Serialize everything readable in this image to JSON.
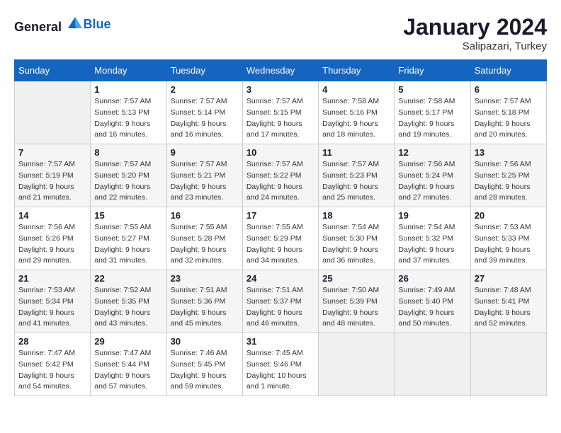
{
  "logo": {
    "text_general": "General",
    "text_blue": "Blue"
  },
  "title": "January 2024",
  "subtitle": "Salipazari, Turkey",
  "weekdays": [
    "Sunday",
    "Monday",
    "Tuesday",
    "Wednesday",
    "Thursday",
    "Friday",
    "Saturday"
  ],
  "weeks": [
    [
      {
        "day": "",
        "info": ""
      },
      {
        "day": "1",
        "info": "Sunrise: 7:57 AM\nSunset: 5:13 PM\nDaylight: 9 hours\nand 16 minutes."
      },
      {
        "day": "2",
        "info": "Sunrise: 7:57 AM\nSunset: 5:14 PM\nDaylight: 9 hours\nand 16 minutes."
      },
      {
        "day": "3",
        "info": "Sunrise: 7:57 AM\nSunset: 5:15 PM\nDaylight: 9 hours\nand 17 minutes."
      },
      {
        "day": "4",
        "info": "Sunrise: 7:58 AM\nSunset: 5:16 PM\nDaylight: 9 hours\nand 18 minutes."
      },
      {
        "day": "5",
        "info": "Sunrise: 7:58 AM\nSunset: 5:17 PM\nDaylight: 9 hours\nand 19 minutes."
      },
      {
        "day": "6",
        "info": "Sunrise: 7:57 AM\nSunset: 5:18 PM\nDaylight: 9 hours\nand 20 minutes."
      }
    ],
    [
      {
        "day": "7",
        "info": "Sunrise: 7:57 AM\nSunset: 5:19 PM\nDaylight: 9 hours\nand 21 minutes."
      },
      {
        "day": "8",
        "info": "Sunrise: 7:57 AM\nSunset: 5:20 PM\nDaylight: 9 hours\nand 22 minutes."
      },
      {
        "day": "9",
        "info": "Sunrise: 7:57 AM\nSunset: 5:21 PM\nDaylight: 9 hours\nand 23 minutes."
      },
      {
        "day": "10",
        "info": "Sunrise: 7:57 AM\nSunset: 5:22 PM\nDaylight: 9 hours\nand 24 minutes."
      },
      {
        "day": "11",
        "info": "Sunrise: 7:57 AM\nSunset: 5:23 PM\nDaylight: 9 hours\nand 25 minutes."
      },
      {
        "day": "12",
        "info": "Sunrise: 7:56 AM\nSunset: 5:24 PM\nDaylight: 9 hours\nand 27 minutes."
      },
      {
        "day": "13",
        "info": "Sunrise: 7:56 AM\nSunset: 5:25 PM\nDaylight: 9 hours\nand 28 minutes."
      }
    ],
    [
      {
        "day": "14",
        "info": "Sunrise: 7:56 AM\nSunset: 5:26 PM\nDaylight: 9 hours\nand 29 minutes."
      },
      {
        "day": "15",
        "info": "Sunrise: 7:55 AM\nSunset: 5:27 PM\nDaylight: 9 hours\nand 31 minutes."
      },
      {
        "day": "16",
        "info": "Sunrise: 7:55 AM\nSunset: 5:28 PM\nDaylight: 9 hours\nand 32 minutes."
      },
      {
        "day": "17",
        "info": "Sunrise: 7:55 AM\nSunset: 5:29 PM\nDaylight: 9 hours\nand 34 minutes."
      },
      {
        "day": "18",
        "info": "Sunrise: 7:54 AM\nSunset: 5:30 PM\nDaylight: 9 hours\nand 36 minutes."
      },
      {
        "day": "19",
        "info": "Sunrise: 7:54 AM\nSunset: 5:32 PM\nDaylight: 9 hours\nand 37 minutes."
      },
      {
        "day": "20",
        "info": "Sunrise: 7:53 AM\nSunset: 5:33 PM\nDaylight: 9 hours\nand 39 minutes."
      }
    ],
    [
      {
        "day": "21",
        "info": "Sunrise: 7:53 AM\nSunset: 5:34 PM\nDaylight: 9 hours\nand 41 minutes."
      },
      {
        "day": "22",
        "info": "Sunrise: 7:52 AM\nSunset: 5:35 PM\nDaylight: 9 hours\nand 43 minutes."
      },
      {
        "day": "23",
        "info": "Sunrise: 7:51 AM\nSunset: 5:36 PM\nDaylight: 9 hours\nand 45 minutes."
      },
      {
        "day": "24",
        "info": "Sunrise: 7:51 AM\nSunset: 5:37 PM\nDaylight: 9 hours\nand 46 minutes."
      },
      {
        "day": "25",
        "info": "Sunrise: 7:50 AM\nSunset: 5:39 PM\nDaylight: 9 hours\nand 48 minutes."
      },
      {
        "day": "26",
        "info": "Sunrise: 7:49 AM\nSunset: 5:40 PM\nDaylight: 9 hours\nand 50 minutes."
      },
      {
        "day": "27",
        "info": "Sunrise: 7:48 AM\nSunset: 5:41 PM\nDaylight: 9 hours\nand 52 minutes."
      }
    ],
    [
      {
        "day": "28",
        "info": "Sunrise: 7:47 AM\nSunset: 5:42 PM\nDaylight: 9 hours\nand 54 minutes."
      },
      {
        "day": "29",
        "info": "Sunrise: 7:47 AM\nSunset: 5:44 PM\nDaylight: 9 hours\nand 57 minutes."
      },
      {
        "day": "30",
        "info": "Sunrise: 7:46 AM\nSunset: 5:45 PM\nDaylight: 9 hours\nand 59 minutes."
      },
      {
        "day": "31",
        "info": "Sunrise: 7:45 AM\nSunset: 5:46 PM\nDaylight: 10 hours\nand 1 minute."
      },
      {
        "day": "",
        "info": ""
      },
      {
        "day": "",
        "info": ""
      },
      {
        "day": "",
        "info": ""
      }
    ]
  ]
}
